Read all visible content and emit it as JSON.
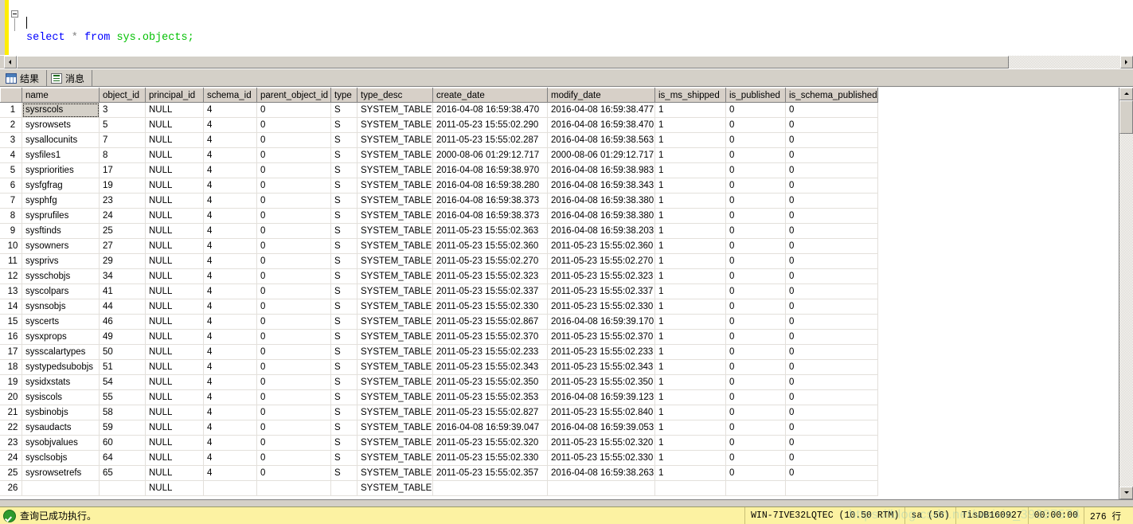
{
  "editor": {
    "fold_marker": "collapse",
    "line1": {
      "kw_select": "select",
      "star": "*",
      "kw_from": "from",
      "identifier": "sys.objects",
      "terminator": ";"
    },
    "full_text": "select * from sys.objects;"
  },
  "tabs": [
    {
      "id": "results",
      "label": "结果",
      "icon": "grid-icon",
      "active": true
    },
    {
      "id": "messages",
      "label": "消息",
      "icon": "message-doc-icon",
      "active": false
    }
  ],
  "grid": {
    "columns": [
      "name",
      "object_id",
      "principal_id",
      "schema_id",
      "parent_object_id",
      "type",
      "type_desc",
      "create_date",
      "modify_date",
      "is_ms_shipped",
      "is_published",
      "is_schema_published"
    ],
    "selected_row": 1,
    "rows": [
      {
        "n": "1",
        "name": "sysrscols",
        "object_id": "3",
        "principal_id": "NULL",
        "schema_id": "4",
        "parent_object_id": "0",
        "type": "S",
        "type_desc": "SYSTEM_TABLE",
        "create_date": "2016-04-08 16:59:38.470",
        "modify_date": "2016-04-08 16:59:38.477",
        "is_ms_shipped": "1",
        "is_published": "0",
        "is_schema_published": "0"
      },
      {
        "n": "2",
        "name": "sysrowsets",
        "object_id": "5",
        "principal_id": "NULL",
        "schema_id": "4",
        "parent_object_id": "0",
        "type": "S",
        "type_desc": "SYSTEM_TABLE",
        "create_date": "2011-05-23 15:55:02.290",
        "modify_date": "2016-04-08 16:59:38.470",
        "is_ms_shipped": "1",
        "is_published": "0",
        "is_schema_published": "0"
      },
      {
        "n": "3",
        "name": "sysallocunits",
        "object_id": "7",
        "principal_id": "NULL",
        "schema_id": "4",
        "parent_object_id": "0",
        "type": "S",
        "type_desc": "SYSTEM_TABLE",
        "create_date": "2011-05-23 15:55:02.287",
        "modify_date": "2016-04-08 16:59:38.563",
        "is_ms_shipped": "1",
        "is_published": "0",
        "is_schema_published": "0"
      },
      {
        "n": "4",
        "name": "sysfiles1",
        "object_id": "8",
        "principal_id": "NULL",
        "schema_id": "4",
        "parent_object_id": "0",
        "type": "S",
        "type_desc": "SYSTEM_TABLE",
        "create_date": "2000-08-06 01:29:12.717",
        "modify_date": "2000-08-06 01:29:12.717",
        "is_ms_shipped": "1",
        "is_published": "0",
        "is_schema_published": "0"
      },
      {
        "n": "5",
        "name": "syspriorities",
        "object_id": "17",
        "principal_id": "NULL",
        "schema_id": "4",
        "parent_object_id": "0",
        "type": "S",
        "type_desc": "SYSTEM_TABLE",
        "create_date": "2016-04-08 16:59:38.970",
        "modify_date": "2016-04-08 16:59:38.983",
        "is_ms_shipped": "1",
        "is_published": "0",
        "is_schema_published": "0"
      },
      {
        "n": "6",
        "name": "sysfgfrag",
        "object_id": "19",
        "principal_id": "NULL",
        "schema_id": "4",
        "parent_object_id": "0",
        "type": "S",
        "type_desc": "SYSTEM_TABLE",
        "create_date": "2016-04-08 16:59:38.280",
        "modify_date": "2016-04-08 16:59:38.343",
        "is_ms_shipped": "1",
        "is_published": "0",
        "is_schema_published": "0"
      },
      {
        "n": "7",
        "name": "sysphfg",
        "object_id": "23",
        "principal_id": "NULL",
        "schema_id": "4",
        "parent_object_id": "0",
        "type": "S",
        "type_desc": "SYSTEM_TABLE",
        "create_date": "2016-04-08 16:59:38.373",
        "modify_date": "2016-04-08 16:59:38.380",
        "is_ms_shipped": "1",
        "is_published": "0",
        "is_schema_published": "0"
      },
      {
        "n": "8",
        "name": "sysprufiles",
        "object_id": "24",
        "principal_id": "NULL",
        "schema_id": "4",
        "parent_object_id": "0",
        "type": "S",
        "type_desc": "SYSTEM_TABLE",
        "create_date": "2016-04-08 16:59:38.373",
        "modify_date": "2016-04-08 16:59:38.380",
        "is_ms_shipped": "1",
        "is_published": "0",
        "is_schema_published": "0"
      },
      {
        "n": "9",
        "name": "sysftinds",
        "object_id": "25",
        "principal_id": "NULL",
        "schema_id": "4",
        "parent_object_id": "0",
        "type": "S",
        "type_desc": "SYSTEM_TABLE",
        "create_date": "2011-05-23 15:55:02.363",
        "modify_date": "2016-04-08 16:59:38.203",
        "is_ms_shipped": "1",
        "is_published": "0",
        "is_schema_published": "0"
      },
      {
        "n": "10",
        "name": "sysowners",
        "object_id": "27",
        "principal_id": "NULL",
        "schema_id": "4",
        "parent_object_id": "0",
        "type": "S",
        "type_desc": "SYSTEM_TABLE",
        "create_date": "2011-05-23 15:55:02.360",
        "modify_date": "2011-05-23 15:55:02.360",
        "is_ms_shipped": "1",
        "is_published": "0",
        "is_schema_published": "0"
      },
      {
        "n": "11",
        "name": "sysprivs",
        "object_id": "29",
        "principal_id": "NULL",
        "schema_id": "4",
        "parent_object_id": "0",
        "type": "S",
        "type_desc": "SYSTEM_TABLE",
        "create_date": "2011-05-23 15:55:02.270",
        "modify_date": "2011-05-23 15:55:02.270",
        "is_ms_shipped": "1",
        "is_published": "0",
        "is_schema_published": "0"
      },
      {
        "n": "12",
        "name": "sysschobjs",
        "object_id": "34",
        "principal_id": "NULL",
        "schema_id": "4",
        "parent_object_id": "0",
        "type": "S",
        "type_desc": "SYSTEM_TABLE",
        "create_date": "2011-05-23 15:55:02.323",
        "modify_date": "2011-05-23 15:55:02.323",
        "is_ms_shipped": "1",
        "is_published": "0",
        "is_schema_published": "0"
      },
      {
        "n": "13",
        "name": "syscolpars",
        "object_id": "41",
        "principal_id": "NULL",
        "schema_id": "4",
        "parent_object_id": "0",
        "type": "S",
        "type_desc": "SYSTEM_TABLE",
        "create_date": "2011-05-23 15:55:02.337",
        "modify_date": "2011-05-23 15:55:02.337",
        "is_ms_shipped": "1",
        "is_published": "0",
        "is_schema_published": "0"
      },
      {
        "n": "14",
        "name": "sysnsobjs",
        "object_id": "44",
        "principal_id": "NULL",
        "schema_id": "4",
        "parent_object_id": "0",
        "type": "S",
        "type_desc": "SYSTEM_TABLE",
        "create_date": "2011-05-23 15:55:02.330",
        "modify_date": "2011-05-23 15:55:02.330",
        "is_ms_shipped": "1",
        "is_published": "0",
        "is_schema_published": "0"
      },
      {
        "n": "15",
        "name": "syscerts",
        "object_id": "46",
        "principal_id": "NULL",
        "schema_id": "4",
        "parent_object_id": "0",
        "type": "S",
        "type_desc": "SYSTEM_TABLE",
        "create_date": "2011-05-23 15:55:02.867",
        "modify_date": "2016-04-08 16:59:39.170",
        "is_ms_shipped": "1",
        "is_published": "0",
        "is_schema_published": "0"
      },
      {
        "n": "16",
        "name": "sysxprops",
        "object_id": "49",
        "principal_id": "NULL",
        "schema_id": "4",
        "parent_object_id": "0",
        "type": "S",
        "type_desc": "SYSTEM_TABLE",
        "create_date": "2011-05-23 15:55:02.370",
        "modify_date": "2011-05-23 15:55:02.370",
        "is_ms_shipped": "1",
        "is_published": "0",
        "is_schema_published": "0"
      },
      {
        "n": "17",
        "name": "sysscalartypes",
        "object_id": "50",
        "principal_id": "NULL",
        "schema_id": "4",
        "parent_object_id": "0",
        "type": "S",
        "type_desc": "SYSTEM_TABLE",
        "create_date": "2011-05-23 15:55:02.233",
        "modify_date": "2011-05-23 15:55:02.233",
        "is_ms_shipped": "1",
        "is_published": "0",
        "is_schema_published": "0"
      },
      {
        "n": "18",
        "name": "systypedsubobjs",
        "object_id": "51",
        "principal_id": "NULL",
        "schema_id": "4",
        "parent_object_id": "0",
        "type": "S",
        "type_desc": "SYSTEM_TABLE",
        "create_date": "2011-05-23 15:55:02.343",
        "modify_date": "2011-05-23 15:55:02.343",
        "is_ms_shipped": "1",
        "is_published": "0",
        "is_schema_published": "0"
      },
      {
        "n": "19",
        "name": "sysidxstats",
        "object_id": "54",
        "principal_id": "NULL",
        "schema_id": "4",
        "parent_object_id": "0",
        "type": "S",
        "type_desc": "SYSTEM_TABLE",
        "create_date": "2011-05-23 15:55:02.350",
        "modify_date": "2011-05-23 15:55:02.350",
        "is_ms_shipped": "1",
        "is_published": "0",
        "is_schema_published": "0"
      },
      {
        "n": "20",
        "name": "sysiscols",
        "object_id": "55",
        "principal_id": "NULL",
        "schema_id": "4",
        "parent_object_id": "0",
        "type": "S",
        "type_desc": "SYSTEM_TABLE",
        "create_date": "2011-05-23 15:55:02.353",
        "modify_date": "2016-04-08 16:59:39.123",
        "is_ms_shipped": "1",
        "is_published": "0",
        "is_schema_published": "0"
      },
      {
        "n": "21",
        "name": "sysbinobjs",
        "object_id": "58",
        "principal_id": "NULL",
        "schema_id": "4",
        "parent_object_id": "0",
        "type": "S",
        "type_desc": "SYSTEM_TABLE",
        "create_date": "2011-05-23 15:55:02.827",
        "modify_date": "2011-05-23 15:55:02.840",
        "is_ms_shipped": "1",
        "is_published": "0",
        "is_schema_published": "0"
      },
      {
        "n": "22",
        "name": "sysaudacts",
        "object_id": "59",
        "principal_id": "NULL",
        "schema_id": "4",
        "parent_object_id": "0",
        "type": "S",
        "type_desc": "SYSTEM_TABLE",
        "create_date": "2016-04-08 16:59:39.047",
        "modify_date": "2016-04-08 16:59:39.053",
        "is_ms_shipped": "1",
        "is_published": "0",
        "is_schema_published": "0"
      },
      {
        "n": "23",
        "name": "sysobjvalues",
        "object_id": "60",
        "principal_id": "NULL",
        "schema_id": "4",
        "parent_object_id": "0",
        "type": "S",
        "type_desc": "SYSTEM_TABLE",
        "create_date": "2011-05-23 15:55:02.320",
        "modify_date": "2011-05-23 15:55:02.320",
        "is_ms_shipped": "1",
        "is_published": "0",
        "is_schema_published": "0"
      },
      {
        "n": "24",
        "name": "sysclsobjs",
        "object_id": "64",
        "principal_id": "NULL",
        "schema_id": "4",
        "parent_object_id": "0",
        "type": "S",
        "type_desc": "SYSTEM_TABLE",
        "create_date": "2011-05-23 15:55:02.330",
        "modify_date": "2011-05-23 15:55:02.330",
        "is_ms_shipped": "1",
        "is_published": "0",
        "is_schema_published": "0"
      },
      {
        "n": "25",
        "name": "sysrowsetrefs",
        "object_id": "65",
        "principal_id": "NULL",
        "schema_id": "4",
        "parent_object_id": "0",
        "type": "S",
        "type_desc": "SYSTEM_TABLE",
        "create_date": "2011-05-23 15:55:02.357",
        "modify_date": "2016-04-08 16:59:38.263",
        "is_ms_shipped": "1",
        "is_published": "0",
        "is_schema_published": "0"
      },
      {
        "n": "26",
        "name": "",
        "object_id": "",
        "principal_id": "NULL",
        "schema_id": "",
        "parent_object_id": "",
        "type": "",
        "type_desc": "SYSTEM_TABLE",
        "create_date": "",
        "modify_date": "",
        "is_ms_shipped": "",
        "is_published": "",
        "is_schema_published": ""
      }
    ]
  },
  "statusbar": {
    "message": "查询已成功执行。",
    "server": "WIN-7IVE32LQTEC (10.50 RTM)",
    "user": "sa (56)",
    "database": "TisDB160927",
    "elapsed": "00:00:00",
    "rowcount": "276 行"
  },
  "watermark": "https://blog.csdn.net/weixin_39397574",
  "colors": {
    "keyword": "#0000ff",
    "identifier": "#00c000",
    "operator": "#808080",
    "null_cell_bg": "#ffffe1",
    "header_bg": "#d7d0c8",
    "status_bg": "#fcf2a2",
    "change_bar": "#ffee00",
    "success_green": "#2e9b2e"
  }
}
